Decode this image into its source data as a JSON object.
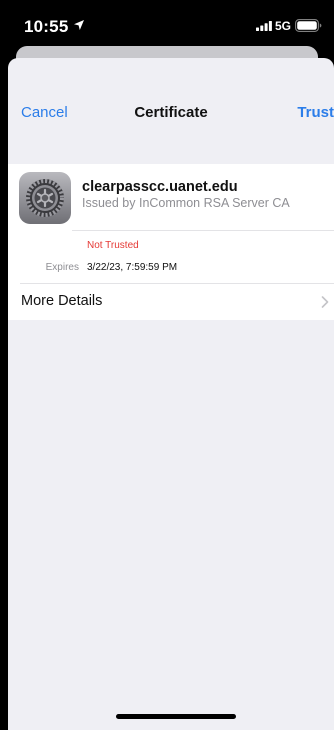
{
  "status_bar": {
    "time": "10:55",
    "network": "5G",
    "icons": [
      "location-arrow-icon",
      "signal-bars-icon",
      "battery-icon"
    ]
  },
  "nav": {
    "cancel_label": "Cancel",
    "title": "Certificate",
    "trust_label": "Trust"
  },
  "certificate": {
    "icon": "settings-gear-icon",
    "name": "clearpasscc.uanet.edu",
    "issuer": "Issued by InCommon RSA Server CA",
    "trust_status": "Not Trusted",
    "expires_label": "Expires",
    "expires_value": "3/22/23, 7:59:59 PM"
  },
  "more_details": {
    "label": "More Details",
    "icon": "chevron-right-icon"
  },
  "colors": {
    "accent": "#2b7de9",
    "warning": "#e53935",
    "sheet_background": "#efeff4"
  }
}
